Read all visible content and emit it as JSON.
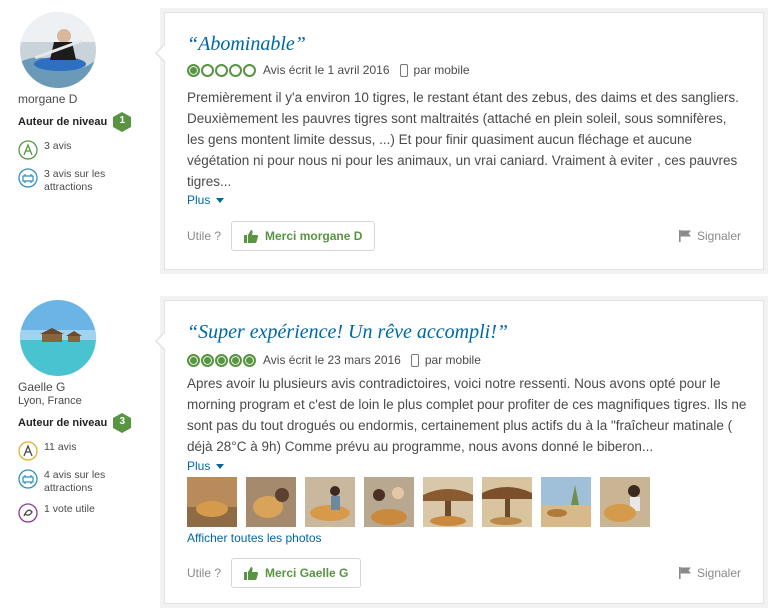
{
  "reviews": [
    {
      "member": {
        "name": "morgane D",
        "location": "",
        "level_label": "Auteur de niveau",
        "level": "1",
        "level_color": "#589442",
        "stats": [
          {
            "icon": "reviews-icon",
            "text": "3 avis"
          },
          {
            "icon": "attraction-icon",
            "text": "3 avis sur les attractions"
          }
        ]
      },
      "title": "“Abominable”",
      "rating": 1,
      "date": "Avis écrit le 1 avril 2016",
      "via": "par mobile",
      "text": "Premièrement il y'a environ 10 tigres, le restant étant des zebus, des daims et des sangliers. Deuxièmement les pauvres tigres sont maltraités (attaché en plein soleil, sous somnifères, les gens montent limite dessus, ...) Et pour finir quasiment aucun fléchage et aucune végétation ni pour nous ni pour les animaux, un vrai caniard. Vraiment à eviter , ces pauvres tigres...",
      "more": "Plus",
      "useful": "Utile ?",
      "thanks": "Merci morgane D",
      "report": "Signaler"
    },
    {
      "member": {
        "name": "Gaelle G",
        "location": "Lyon, France",
        "level_label": "Auteur de niveau",
        "level": "3",
        "level_color": "#589442",
        "stats": [
          {
            "icon": "reviews-icon",
            "text": "11 avis"
          },
          {
            "icon": "attraction-icon",
            "text": "4 avis sur les attractions"
          },
          {
            "icon": "helpful-vote-icon",
            "text": "1 vote utile"
          }
        ]
      },
      "title": "“Super expérience! Un rêve accompli!”",
      "rating": 5,
      "date": "Avis écrit le 23 mars 2016",
      "via": "par mobile",
      "text": "Apres avoir lu plusieurs avis contradictoires, voici notre ressenti. Nous avons opté pour le morning program et c'est de loin le plus complet pour profiter de ces magnifiques tigres. Ils ne sont pas du tout drogués ou endormis, certainement plus actifs du à la \"fraîcheur matinale ( déjà 28°C à 9h) Comme prévu au programme, nous avons donné le biberon...",
      "more": "Plus",
      "all_photos": "Afficher toutes les photos",
      "useful": "Utile ?",
      "thanks": "Merci Gaelle G",
      "report": "Signaler"
    }
  ]
}
